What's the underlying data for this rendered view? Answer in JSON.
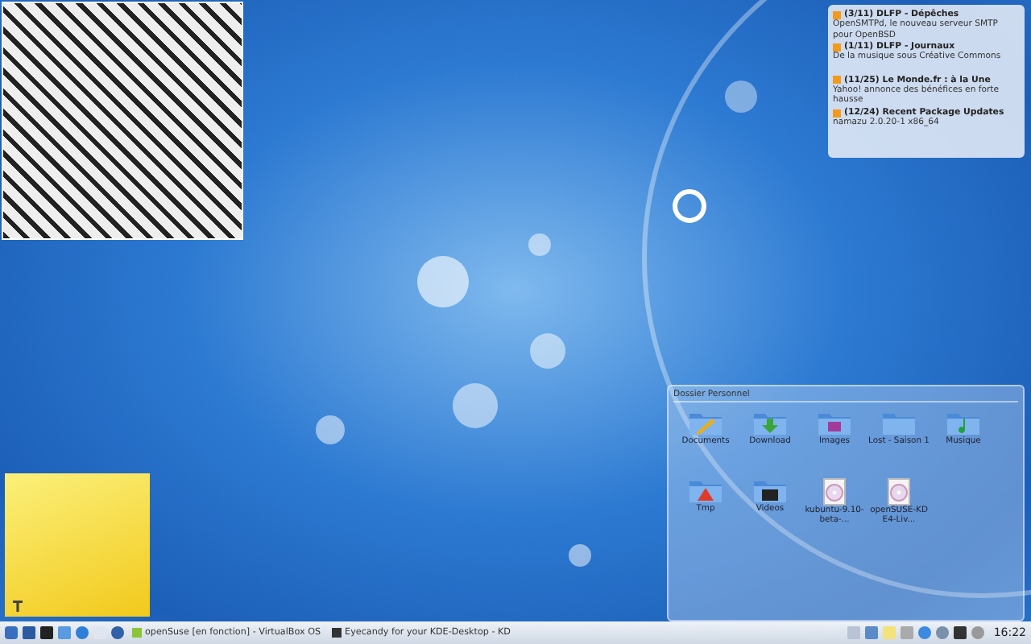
{
  "news": [
    {
      "title": "(3/11) DLFP - Dépêches",
      "body": "OpenSMTPd, le nouveau serveur SMTP pour OpenBSD"
    },
    {
      "title": "(1/11) DLFP - Journaux",
      "body": "De la musique sous Créative Commons"
    },
    {
      "title": "(11/25) Le Monde.fr : à la Une",
      "body": "Yahoo! annonce des bénéfices en forte hausse"
    },
    {
      "title": "(12/24) Recent Package Updates",
      "body": "namazu 2.0.20-1 x86_64"
    }
  ],
  "folder": {
    "title": "Dossier Personnel",
    "items": [
      {
        "label": "Documents",
        "kind": "pencil"
      },
      {
        "label": "Download",
        "kind": "download"
      },
      {
        "label": "Images",
        "kind": "images"
      },
      {
        "label": "Lost - Saison 1",
        "kind": "plain"
      },
      {
        "label": "Musique",
        "kind": "music"
      },
      {
        "label": "Tmp",
        "kind": "warning"
      },
      {
        "label": "Videos",
        "kind": "video"
      },
      {
        "label": "kubuntu-9.10-beta-...",
        "kind": "disc"
      },
      {
        "label": "openSUSE-KDE4-Liv...",
        "kind": "disc"
      }
    ]
  },
  "taskbar": {
    "tasks": [
      {
        "label": "openSuse [en fonction] - VirtualBox OS",
        "kind": "vm"
      },
      {
        "label": "Eyecandy for your KDE-Desktop - KD",
        "kind": "film"
      }
    ],
    "clock": "16:22"
  }
}
